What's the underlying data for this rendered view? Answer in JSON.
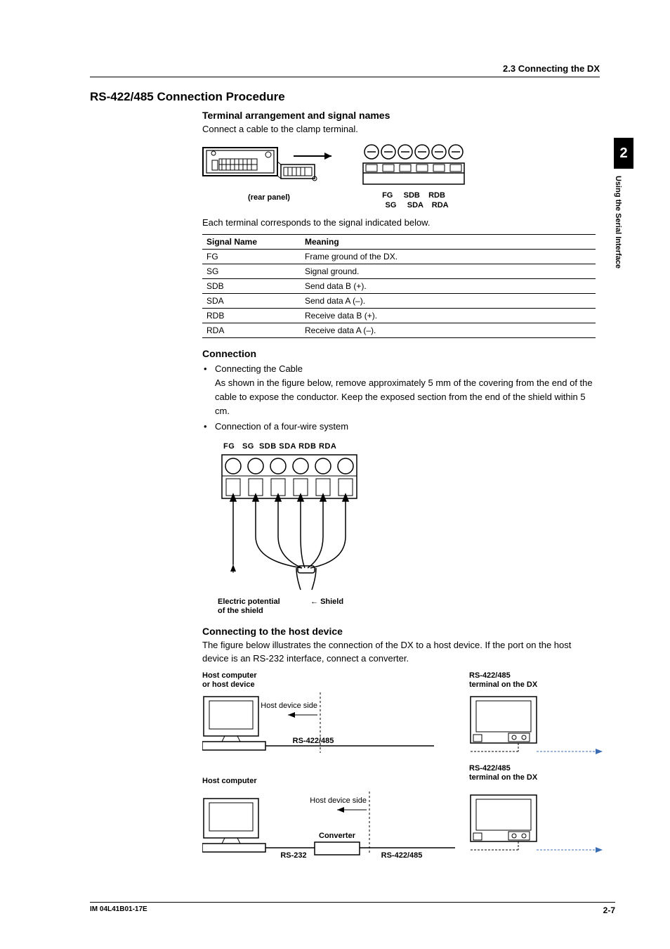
{
  "header": {
    "crumb": "2.3  Connecting the DX",
    "section_title": "RS-422/485 Connection Procedure"
  },
  "sidebar": {
    "chapter_num": "2",
    "chapter_title": "Using the Serial Interface"
  },
  "terminal": {
    "title": "Terminal arrangement and signal names",
    "instr": "Connect a cable to the clamp terminal.",
    "rear_label": "(rear panel)",
    "pin_row1": "FG     SDB    RDB",
    "pin_row2": "   SG     SDA    RDA",
    "table_intro": "Each terminal corresponds to the signal indicated below.",
    "table": {
      "head": {
        "c1": "Signal Name",
        "c2": "Meaning"
      },
      "rows": [
        {
          "c1": "FG",
          "c2": "Frame ground of the DX."
        },
        {
          "c1": "SG",
          "c2": "Signal ground."
        },
        {
          "c1": "SDB",
          "c2": "Send data B (+)."
        },
        {
          "c1": "SDA",
          "c2": "Send data A (–)."
        },
        {
          "c1": "RDB",
          "c2": "Receive data B (+)."
        },
        {
          "c1": "RDA",
          "c2": "Receive data A (–)."
        }
      ]
    }
  },
  "connection": {
    "title": "Connection",
    "b1": "Connecting the Cable",
    "b1_text": "As shown in the figure below, remove approximately 5 mm of the covering from the end of the cable to expose the conductor. Keep the exposed section from the end of the shield within 5 cm.",
    "b2": "Connection of a four-wire system",
    "cable_pins": "FG   SG  SDB SDA RDB RDA",
    "potential_label": "Electric potential\nof the shield",
    "shield_label": "Shield"
  },
  "host": {
    "title": "Connecting to the host device",
    "intro": "The figure below illustrates the connection of the DX to a host device. If the port on the host device is an RS-232 interface, connect a converter.",
    "fig1": {
      "left_title": "Host computer\nor host device",
      "right_title": "RS-422/485\nterminal on the DX",
      "host_side": "Host device side",
      "bus": "RS-422/485"
    },
    "fig2": {
      "left_title": "Host computer",
      "right_title": "RS-422/485\nterminal on the DX",
      "host_side": "Host device side",
      "converter": "Converter",
      "rs232": "RS-232",
      "bus": "RS-422/485"
    }
  },
  "footer": {
    "doc_id": "IM 04L41B01-17E",
    "page": "2-7"
  }
}
